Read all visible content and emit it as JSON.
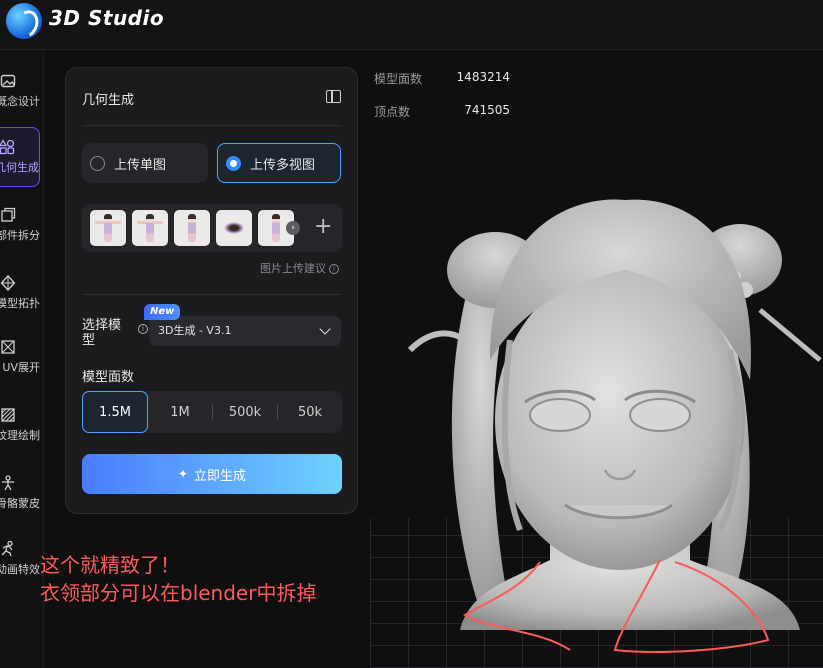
{
  "app": {
    "title": "3D Studio"
  },
  "sidebar": {
    "items": [
      {
        "label": "概念设计",
        "icon": "image-sparkle-icon"
      },
      {
        "label": "几何生成",
        "icon": "shapes-icon",
        "active": true
      },
      {
        "label": "部件拆分",
        "icon": "cube-split-icon"
      },
      {
        "label": "模型拓扑",
        "icon": "polygon-icon"
      },
      {
        "label": "UV展开",
        "icon": "uv-unwrap-icon"
      },
      {
        "label": "纹理绘制",
        "icon": "brush-pattern-icon"
      },
      {
        "label": "骨骼蒙皮",
        "icon": "figure-icon"
      },
      {
        "label": "动画特效",
        "icon": "running-figure-icon"
      }
    ]
  },
  "panel": {
    "title": "几何生成",
    "upload_single": "上传单图",
    "upload_multi": "上传多视图",
    "upload_hint": "图片上传建议",
    "model_select_label": "选择模型",
    "new_badge": "New",
    "model_value": "3D生成 - V3.1",
    "faces_label": "模型面数",
    "face_options": [
      "1.5M",
      "1M",
      "500k",
      "50k"
    ],
    "selected_face_option": "1.5M",
    "generate_button": "立即生成"
  },
  "stats": {
    "faces_label": "模型面数",
    "faces_value": "1483214",
    "vertices_label": "顶点数",
    "vertices_value": "741505"
  },
  "annotation": {
    "line1": "这个就精致了！",
    "line2": "衣领部分可以在blender中拆掉",
    "color": "#ff5a5a"
  },
  "colors": {
    "accent": "#4da3ff",
    "active_nav": "#6a4cff"
  }
}
